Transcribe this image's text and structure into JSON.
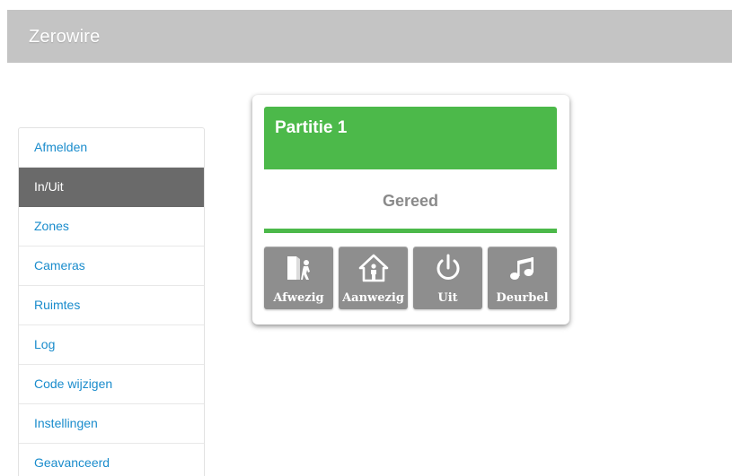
{
  "app": {
    "title": "Zerowire"
  },
  "sidebar": {
    "items": [
      {
        "label": "Afmelden",
        "active": false
      },
      {
        "label": "In/Uit",
        "active": true
      },
      {
        "label": "Zones",
        "active": false
      },
      {
        "label": "Cameras",
        "active": false
      },
      {
        "label": "Ruimtes",
        "active": false
      },
      {
        "label": "Log",
        "active": false
      },
      {
        "label": "Code wijzigen",
        "active": false
      },
      {
        "label": "Instellingen",
        "active": false
      },
      {
        "label": "Geavanceerd",
        "active": false
      }
    ]
  },
  "partition": {
    "title": "Partitie 1",
    "status": "Gereed",
    "status_color": "#4cb94a",
    "buttons": [
      {
        "label": "Afwezig",
        "icon": "door-exit-icon"
      },
      {
        "label": "Aanwezig",
        "icon": "home-person-icon"
      },
      {
        "label": "Uit",
        "icon": "power-icon"
      },
      {
        "label": "Deurbel",
        "icon": "music-note-icon"
      }
    ]
  }
}
